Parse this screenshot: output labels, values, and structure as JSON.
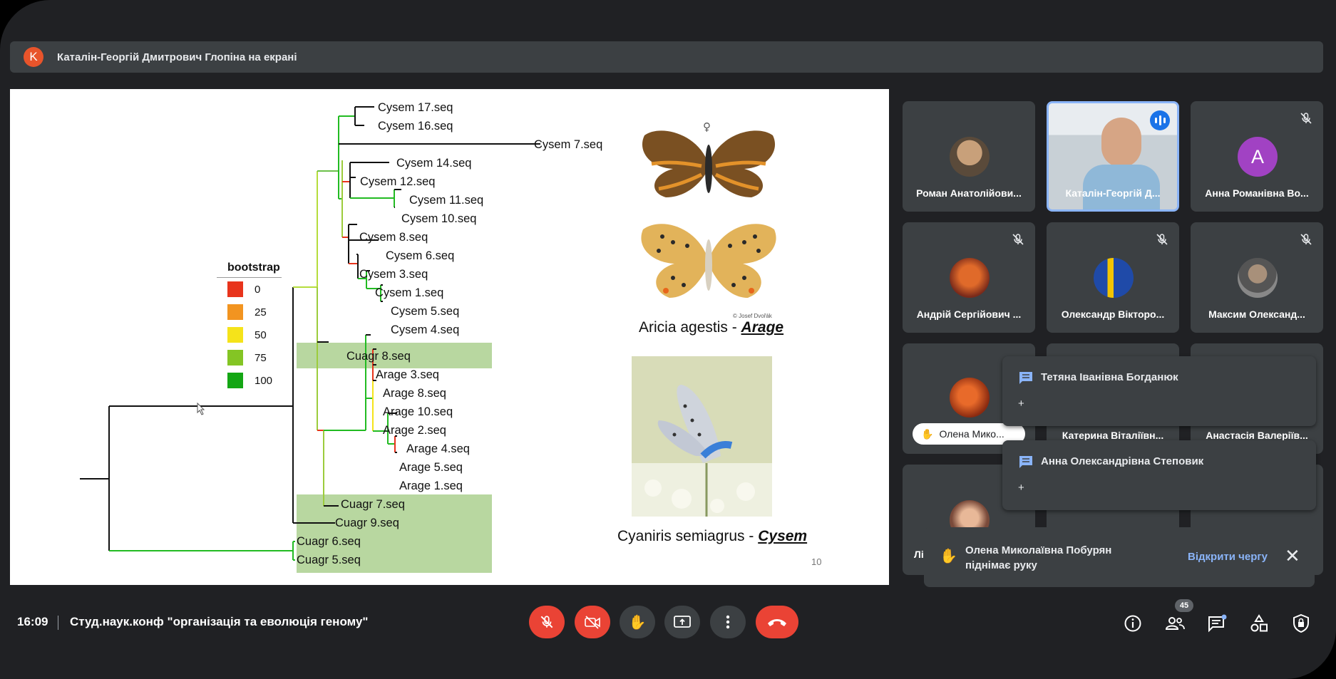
{
  "presenter_bar": {
    "avatar_letter": "K",
    "text": "Каталін-Георгій Дмитрович Глопіна на екрані"
  },
  "slide": {
    "legend": {
      "title": "bootstrap",
      "items": [
        {
          "value": "0",
          "color": "#e8341c"
        },
        {
          "value": "25",
          "color": "#f29420"
        },
        {
          "value": "50",
          "color": "#f5e31a"
        },
        {
          "value": "75",
          "color": "#84c524"
        },
        {
          "value": "100",
          "color": "#14a614"
        }
      ]
    },
    "tree_leaves": [
      "Cysem 17.seq",
      "Cysem 16.seq",
      "Cysem 7.seq",
      "Cysem 14.seq",
      "Cysem 12.seq",
      "Cysem 11.seq",
      "Cysem 10.seq",
      "Cysem 8.seq",
      "Cysem 6.seq",
      "Cysem 3.seq",
      "Cysem 1.seq",
      "Cysem 5.seq",
      "Cysem 4.seq",
      "Cuagr 8.seq",
      "Arage 3.seq",
      "Arage 8.seq",
      "Arage 10.seq",
      "Arage 2.seq",
      "Arage 4.seq",
      "Arage 5.seq",
      "Arage 1.seq",
      "Cuagr 7.seq",
      "Cuagr 9.seq",
      "Cuagr 6.seq",
      "Cuagr 5.seq"
    ],
    "female_symbol": "♀",
    "photo_credit": "© Josef Dvořák",
    "species_1_name": "Aricia agestis - ",
    "species_1_abbr": "Arage",
    "species_2_name": "Cyaniris semiagrus - ",
    "species_2_abbr": "Cysem",
    "slide_number": "10"
  },
  "participants": [
    {
      "name": "Роман Анатолійови...",
      "muted": false
    },
    {
      "name": "Каталін-Георгій Д...",
      "muted": false,
      "speaking": true
    },
    {
      "name": "Анна Романівна Во...",
      "muted": true,
      "avatar_letter": "A"
    },
    {
      "name": "Андрій Сергійович ...",
      "muted": true
    },
    {
      "name": "Олександр Вікторо...",
      "muted": true
    },
    {
      "name": "Максим Олександ...",
      "muted": true
    },
    {
      "name": "Олена Мико...",
      "hand_raised": true
    },
    {
      "name": "Катерина Віталіївн..."
    },
    {
      "name": "Анастасія Валеріїв..."
    },
    {
      "name": "Лі"
    }
  ],
  "chat_notifications": [
    {
      "name": "Тетяна Іванівна Богданюк",
      "plus": "+"
    },
    {
      "name": "Анна Олександрівна Степовик",
      "plus": "+"
    }
  ],
  "hand_toast": {
    "text": "Олена Миколаївна Побурян піднімає руку",
    "action": "Відкрити чергу"
  },
  "bottom_bar": {
    "time": "16:09",
    "meeting_title": "Студ.наук.конф \"організація та еволюція геному\"",
    "people_count": "45"
  }
}
